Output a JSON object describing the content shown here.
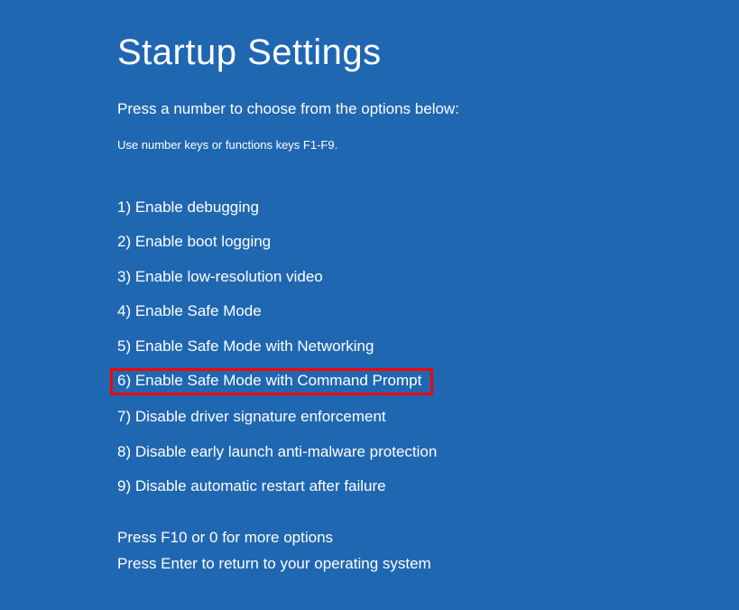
{
  "title": "Startup Settings",
  "instruction": "Press a number to choose from the options below:",
  "hint": "Use number keys or functions keys F1-F9.",
  "options": [
    {
      "label": "1) Enable debugging",
      "highlighted": false
    },
    {
      "label": "2) Enable boot logging",
      "highlighted": false
    },
    {
      "label": "3) Enable low-resolution video",
      "highlighted": false
    },
    {
      "label": "4) Enable Safe Mode",
      "highlighted": false
    },
    {
      "label": "5) Enable Safe Mode with Networking",
      "highlighted": false
    },
    {
      "label": "6) Enable Safe Mode with Command Prompt",
      "highlighted": true
    },
    {
      "label": "7) Disable driver signature enforcement",
      "highlighted": false
    },
    {
      "label": "8) Disable early launch anti-malware protection",
      "highlighted": false
    },
    {
      "label": "9) Disable automatic restart after failure",
      "highlighted": false
    }
  ],
  "footer": {
    "line1": "Press F10 or 0 for more options",
    "line2": "Press Enter to return to your operating system"
  }
}
